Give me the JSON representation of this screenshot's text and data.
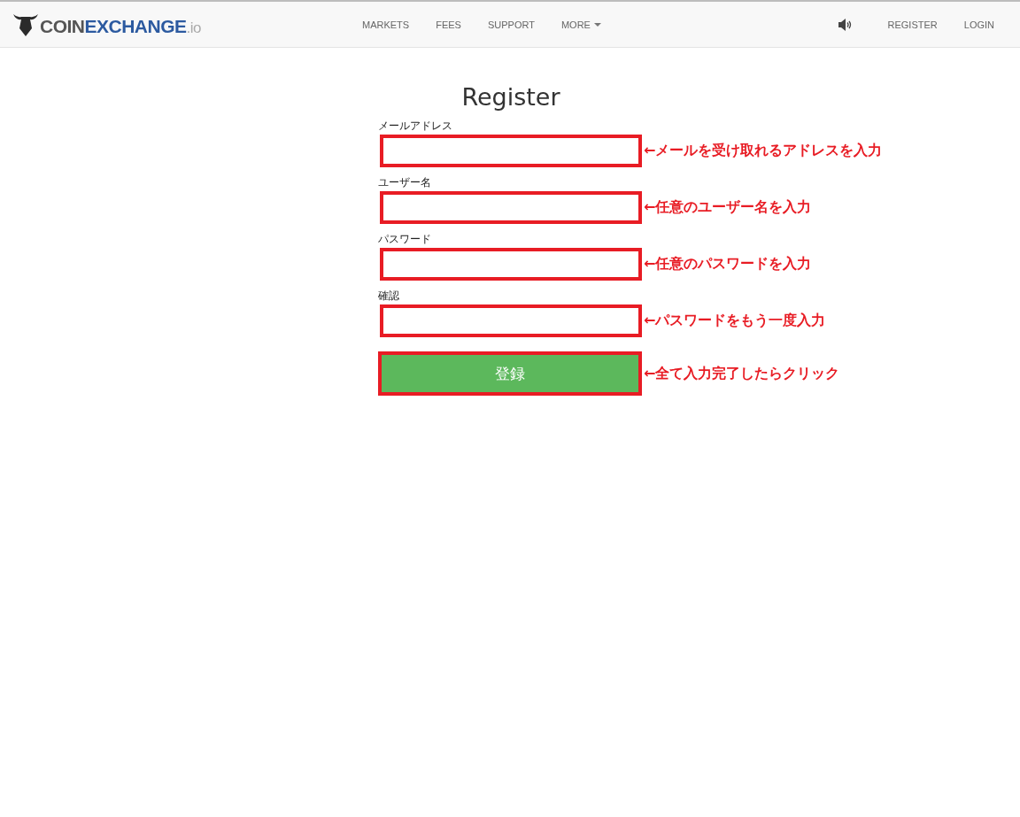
{
  "navbar": {
    "logo": {
      "main": "COIN",
      "accent": "EXCHANGE",
      "suffix": ".io"
    },
    "menu": [
      {
        "label": "MARKETS",
        "dropdown": false
      },
      {
        "label": "FEES",
        "dropdown": false
      },
      {
        "label": "SUPPORT",
        "dropdown": false
      },
      {
        "label": "MORE",
        "dropdown": true
      }
    ],
    "right": [
      {
        "kind": "sound"
      },
      {
        "kind": "link",
        "label": "REGISTER"
      },
      {
        "kind": "link",
        "label": "LOGIN"
      }
    ]
  },
  "form": {
    "title": "Register",
    "fields": [
      {
        "label": "メールアドレス",
        "note": "←メールを受け取れるアドレスを入力"
      },
      {
        "label": "ユーザー名",
        "note": "←任意のユーザー名を入力"
      },
      {
        "label": "パスワード",
        "note": "←任意のパスワードを入力"
      },
      {
        "label": "確認",
        "note": "←パスワードをもう一度入力"
      }
    ],
    "submit": {
      "label": "登録",
      "note": "←全て入力完了したらクリック"
    }
  }
}
